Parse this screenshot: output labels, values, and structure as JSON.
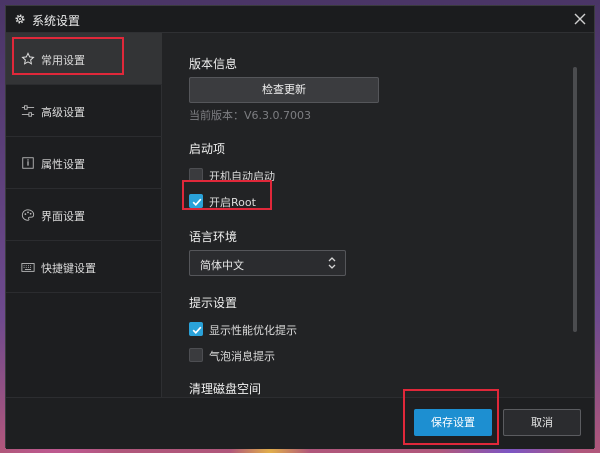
{
  "window": {
    "title": "系统设置"
  },
  "sidebar": {
    "items": [
      {
        "label": "常用设置",
        "icon": "star-icon",
        "active": true
      },
      {
        "label": "高级设置",
        "icon": "sliders-icon",
        "active": false
      },
      {
        "label": "属性设置",
        "icon": "info-icon",
        "active": false
      },
      {
        "label": "界面设置",
        "icon": "palette-icon",
        "active": false
      },
      {
        "label": "快捷键设置",
        "icon": "keyboard-icon",
        "active": false
      }
    ]
  },
  "main": {
    "version_section": {
      "title": "版本信息",
      "check_update_label": "检查更新",
      "current_version": "当前版本：V6.3.0.7003"
    },
    "startup_section": {
      "title": "启动项",
      "options": [
        {
          "label": "开机自动启动",
          "checked": false
        },
        {
          "label": "开启Root",
          "checked": true
        }
      ]
    },
    "language_section": {
      "title": "语言环境",
      "selected": "简体中文"
    },
    "tips_section": {
      "title": "提示设置",
      "options": [
        {
          "label": "显示性能优化提示",
          "checked": true
        },
        {
          "label": "气泡消息提示",
          "checked": false
        }
      ]
    },
    "disk_section": {
      "title": "清理磁盘空间"
    }
  },
  "footer": {
    "save_label": "保存设置",
    "cancel_label": "取消"
  },
  "colors": {
    "accent": "#1d8fd1",
    "checkbox_checked": "#2aa2d9",
    "highlight": "#e0283a",
    "dialog_bg": "#222325"
  }
}
